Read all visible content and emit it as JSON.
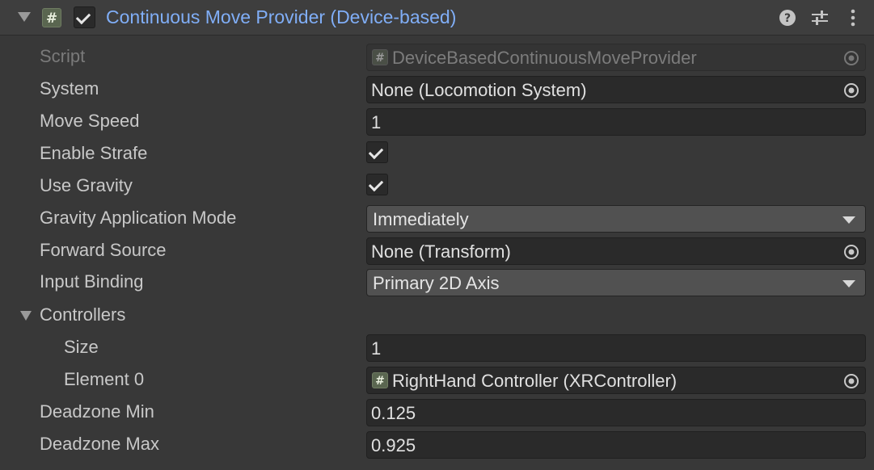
{
  "component": {
    "title": "Continuous Move Provider (Device-based)",
    "enabled": true,
    "header_icons": [
      "help-icon",
      "presets-icon",
      "context-menu-icon"
    ]
  },
  "fields": {
    "script": {
      "label": "Script",
      "value": "DeviceBasedContinuousMoveProvider"
    },
    "system": {
      "label": "System",
      "value": "None (Locomotion System)"
    },
    "move_speed": {
      "label": "Move Speed",
      "value": "1"
    },
    "enable_strafe": {
      "label": "Enable Strafe",
      "checked": true
    },
    "use_gravity": {
      "label": "Use Gravity",
      "checked": true
    },
    "gravity_mode": {
      "label": "Gravity Application Mode",
      "value": "Immediately"
    },
    "forward_source": {
      "label": "Forward Source",
      "value": "None (Transform)"
    },
    "input_binding": {
      "label": "Input Binding",
      "value": "Primary 2D Axis"
    },
    "controllers": {
      "label": "Controllers",
      "expanded": true,
      "size": {
        "label": "Size",
        "value": "1"
      },
      "elements": [
        {
          "label": "Element 0",
          "value": "RightHand Controller (XRController)"
        }
      ]
    },
    "deadzone_min": {
      "label": "Deadzone Min",
      "value": "0.125"
    },
    "deadzone_max": {
      "label": "Deadzone Max",
      "value": "0.925"
    }
  },
  "colors": {
    "background": "#383838",
    "title": "#80aef7",
    "field_bg": "#2a2a2a",
    "dropdown_bg": "#515151"
  }
}
